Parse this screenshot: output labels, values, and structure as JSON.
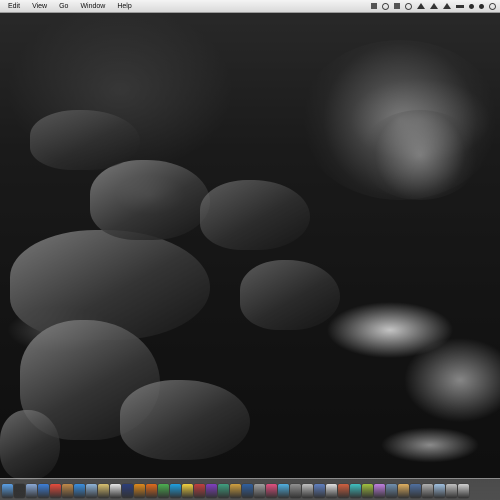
{
  "menubar": {
    "items": [
      {
        "label": "Edit"
      },
      {
        "label": "View"
      },
      {
        "label": "Go"
      },
      {
        "label": "Window"
      },
      {
        "label": "Help"
      }
    ],
    "status_icons": [
      {
        "name": "dropbox-icon"
      },
      {
        "name": "circle-icon"
      },
      {
        "name": "square-icon"
      },
      {
        "name": "timemachine-icon"
      },
      {
        "name": "bluetooth-icon"
      },
      {
        "name": "wifi-icon"
      },
      {
        "name": "volume-icon"
      },
      {
        "name": "battery-icon"
      },
      {
        "name": "clock-icon"
      },
      {
        "name": "user-icon"
      },
      {
        "name": "spotlight-icon"
      }
    ]
  },
  "dock": {
    "icons": [
      {
        "name": "finder-icon",
        "color": "#5aa0e6"
      },
      {
        "name": "dashboard-icon",
        "color": "#333333"
      },
      {
        "name": "mail-icon",
        "color": "#8aa9d6"
      },
      {
        "name": "safari-icon",
        "color": "#3d7fd8"
      },
      {
        "name": "ical-icon",
        "color": "#e64b3c"
      },
      {
        "name": "addressbook-icon",
        "color": "#c08a4a"
      },
      {
        "name": "itunes-icon",
        "color": "#3a8fe0"
      },
      {
        "name": "iphoto-icon",
        "color": "#8fb4d8"
      },
      {
        "name": "preview-icon",
        "color": "#d8c070"
      },
      {
        "name": "textedit-icon",
        "color": "#e8e8e8"
      },
      {
        "name": "photoshop-icon",
        "color": "#2c3e7a"
      },
      {
        "name": "illustrator-icon",
        "color": "#e08a1c"
      },
      {
        "name": "firefox-icon",
        "color": "#e06a1c"
      },
      {
        "name": "chrome-icon",
        "color": "#4caf50"
      },
      {
        "name": "skype-icon",
        "color": "#1ea0e0"
      },
      {
        "name": "notes-icon",
        "color": "#f0d040"
      },
      {
        "name": "app-icon-17",
        "color": "#c04040"
      },
      {
        "name": "app-icon-18",
        "color": "#8040c0"
      },
      {
        "name": "app-icon-19",
        "color": "#40a080"
      },
      {
        "name": "app-icon-20",
        "color": "#d0a040"
      },
      {
        "name": "app-icon-21",
        "color": "#3060a0"
      },
      {
        "name": "app-icon-22",
        "color": "#a0a0a0"
      },
      {
        "name": "app-icon-23",
        "color": "#e05080"
      },
      {
        "name": "app-icon-24",
        "color": "#50b0e0"
      },
      {
        "name": "app-icon-25",
        "color": "#909090"
      },
      {
        "name": "app-icon-26",
        "color": "#c0c0c0"
      },
      {
        "name": "app-icon-27",
        "color": "#6080c0"
      },
      {
        "name": "app-icon-28",
        "color": "#e0e0e0"
      },
      {
        "name": "app-icon-29",
        "color": "#d06040"
      },
      {
        "name": "app-icon-30",
        "color": "#40c0c0"
      },
      {
        "name": "app-icon-31",
        "color": "#a0c040"
      },
      {
        "name": "app-icon-32",
        "color": "#c080e0"
      },
      {
        "name": "app-icon-33",
        "color": "#7090b0"
      },
      {
        "name": "app-icon-34",
        "color": "#e0b060"
      },
      {
        "name": "app-icon-35",
        "color": "#5070a0"
      },
      {
        "name": "app-icon-36",
        "color": "#b0b0b0"
      },
      {
        "name": "downloads-stack-icon",
        "color": "#a0c0e0"
      },
      {
        "name": "documents-stack-icon",
        "color": "#c0c0c0"
      },
      {
        "name": "trash-icon",
        "color": "#d0d0d0"
      }
    ]
  }
}
